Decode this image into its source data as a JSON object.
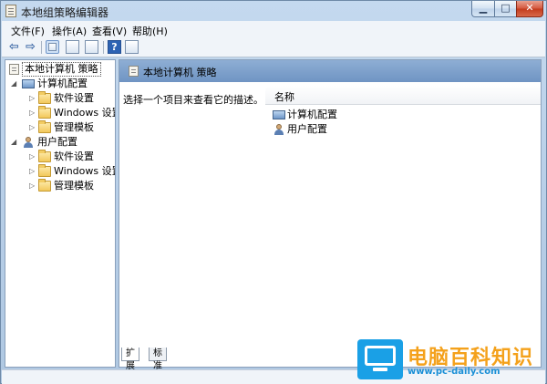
{
  "window": {
    "title": "本地组策略编辑器"
  },
  "menu": [
    "文件(F)",
    "操作(A)",
    "查看(V)",
    "帮助(H)"
  ],
  "tree": {
    "root": "本地计算机 策略",
    "computer_config": "计算机配置",
    "computer_children": [
      "软件设置",
      "Windows 设置",
      "管理模板"
    ],
    "user_config": "用户配置",
    "user_children": [
      "软件设置",
      "Windows 设置",
      "管理模板"
    ]
  },
  "right": {
    "header": "本地计算机 策略",
    "description": "选择一个项目来查看它的描述。",
    "column": "名称",
    "items": [
      "计算机配置",
      "用户配置"
    ]
  },
  "tabs": [
    "扩展",
    "标准"
  ],
  "watermark": {
    "text": "电脑百科知识",
    "url": "www.pc-daily.com"
  },
  "colors": {
    "header_blue": "#7a9dcb",
    "watermark_orange": "#f4a11b",
    "watermark_blue": "#1aa0e6"
  }
}
